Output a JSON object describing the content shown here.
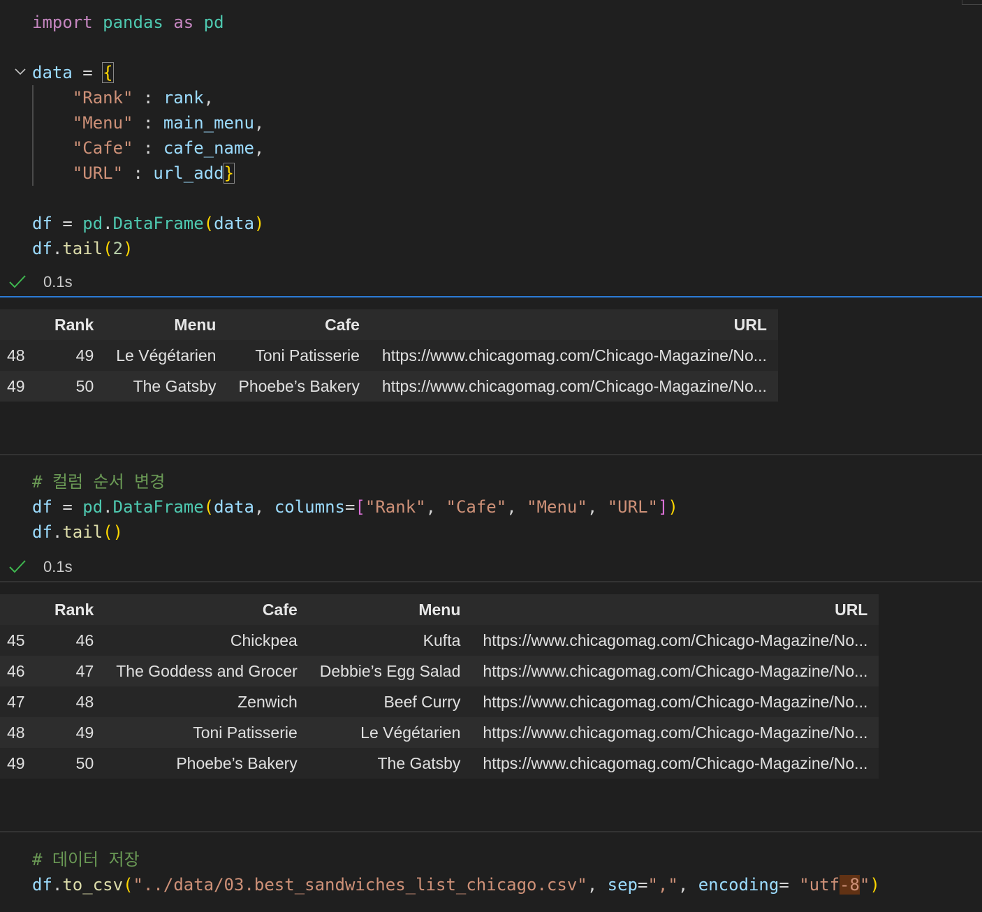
{
  "cell1": {
    "lines": [
      [
        [
          "kw",
          "import"
        ],
        [
          "op",
          " "
        ],
        [
          "mod",
          "pandas"
        ],
        [
          "op",
          " "
        ],
        [
          "kw",
          "as"
        ],
        [
          "op",
          " "
        ],
        [
          "mod",
          "pd"
        ]
      ],
      [],
      [
        [
          "var",
          "data"
        ],
        [
          "op",
          " = "
        ],
        [
          "br1 bracket-match",
          "{"
        ]
      ],
      [
        [
          "op",
          "    "
        ],
        [
          "str",
          "\"Rank\""
        ],
        [
          "op",
          " : "
        ],
        [
          "var",
          "rank"
        ],
        [
          "op",
          ","
        ]
      ],
      [
        [
          "op",
          "    "
        ],
        [
          "str",
          "\"Menu\""
        ],
        [
          "op",
          " : "
        ],
        [
          "var",
          "main_menu"
        ],
        [
          "op",
          ","
        ]
      ],
      [
        [
          "op",
          "    "
        ],
        [
          "str",
          "\"Cafe\""
        ],
        [
          "op",
          " : "
        ],
        [
          "var",
          "cafe_name"
        ],
        [
          "op",
          ","
        ]
      ],
      [
        [
          "op",
          "    "
        ],
        [
          "str",
          "\"URL\""
        ],
        [
          "op",
          " : "
        ],
        [
          "var",
          "url_add"
        ],
        [
          "br1 bracket-match",
          "}"
        ]
      ],
      [],
      [
        [
          "var",
          "df"
        ],
        [
          "op",
          " = "
        ],
        [
          "mod",
          "pd"
        ],
        [
          "op",
          "."
        ],
        [
          "mod",
          "DataFrame"
        ],
        [
          "br1",
          "("
        ],
        [
          "var",
          "data"
        ],
        [
          "br1",
          ")"
        ]
      ],
      [
        [
          "var",
          "df"
        ],
        [
          "op",
          "."
        ],
        [
          "fn",
          "tail"
        ],
        [
          "br1",
          "("
        ],
        [
          "num",
          "2"
        ],
        [
          "br1",
          ")"
        ]
      ]
    ],
    "time": "0.1s"
  },
  "table1": {
    "headers": [
      "",
      "Rank",
      "Menu",
      "Cafe",
      "URL"
    ],
    "rows": [
      [
        "48",
        "49",
        "Le Végétarien",
        "Toni Patisserie",
        "https://www.chicagomag.com/Chicago-Magazine/No..."
      ],
      [
        "49",
        "50",
        "The Gatsby",
        "Phoebe’s Bakery",
        "https://www.chicagomag.com/Chicago-Magazine/No..."
      ]
    ]
  },
  "cell2": {
    "lines": [
      [
        [
          "cm",
          "# 컬럼 순서 변경"
        ]
      ],
      [
        [
          "var",
          "df"
        ],
        [
          "op",
          " = "
        ],
        [
          "mod",
          "pd"
        ],
        [
          "op",
          "."
        ],
        [
          "mod",
          "DataFrame"
        ],
        [
          "br1",
          "("
        ],
        [
          "var",
          "data"
        ],
        [
          "op",
          ", "
        ],
        [
          "var",
          "columns"
        ],
        [
          "op",
          "="
        ],
        [
          "br2",
          "["
        ],
        [
          "str",
          "\"Rank\""
        ],
        [
          "op",
          ", "
        ],
        [
          "str",
          "\"Cafe\""
        ],
        [
          "op",
          ", "
        ],
        [
          "str",
          "\"Menu\""
        ],
        [
          "op",
          ", "
        ],
        [
          "str",
          "\"URL\""
        ],
        [
          "br2",
          "]"
        ],
        [
          "br1",
          ")"
        ]
      ],
      [
        [
          "var",
          "df"
        ],
        [
          "op",
          "."
        ],
        [
          "fn",
          "tail"
        ],
        [
          "br1",
          "()"
        ]
      ]
    ],
    "time": "0.1s"
  },
  "table2": {
    "headers": [
      "",
      "Rank",
      "Cafe",
      "Menu",
      "URL"
    ],
    "rows": [
      [
        "45",
        "46",
        "Chickpea",
        "Kufta",
        "https://www.chicagomag.com/Chicago-Magazine/No..."
      ],
      [
        "46",
        "47",
        "The Goddess and Grocer",
        "Debbie’s Egg Salad",
        "https://www.chicagomag.com/Chicago-Magazine/No..."
      ],
      [
        "47",
        "48",
        "Zenwich",
        "Beef Curry",
        "https://www.chicagomag.com/Chicago-Magazine/No..."
      ],
      [
        "48",
        "49",
        "Toni Patisserie",
        "Le Végétarien",
        "https://www.chicagomag.com/Chicago-Magazine/No..."
      ],
      [
        "49",
        "50",
        "Phoebe’s Bakery",
        "The Gatsby",
        "https://www.chicagomag.com/Chicago-Magazine/No..."
      ]
    ]
  },
  "cell3": {
    "lines": [
      [
        [
          "cm",
          "# 데이터 저장"
        ]
      ],
      [
        [
          "var",
          "df"
        ],
        [
          "op",
          "."
        ],
        [
          "fn",
          "to_csv"
        ],
        [
          "br1",
          "("
        ],
        [
          "str",
          "\"../data/03.best_sandwiches_list_chicago.csv\""
        ],
        [
          "op",
          ", "
        ],
        [
          "var",
          "sep"
        ],
        [
          "op",
          "="
        ],
        [
          "str",
          "\",\""
        ],
        [
          "op",
          ", "
        ],
        [
          "var",
          "encoding"
        ],
        [
          "op",
          "= "
        ],
        [
          "str",
          "\"utf"
        ],
        [
          "str hl-sel",
          "-8"
        ],
        [
          "str",
          "\""
        ],
        [
          "br1",
          ")"
        ]
      ]
    ]
  }
}
